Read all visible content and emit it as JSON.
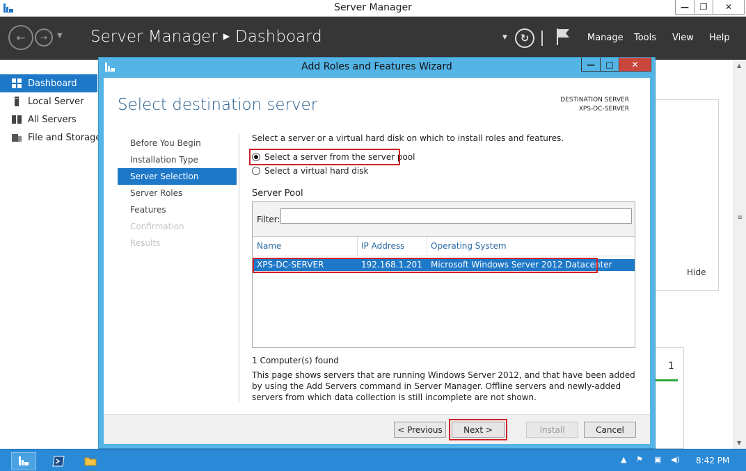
{
  "server_manager": {
    "window_title": "Server Manager",
    "breadcrumb_app": "Server Manager",
    "breadcrumb_page": "Dashboard",
    "menu": {
      "manage": "Manage",
      "tools": "Tools",
      "view": "View",
      "help": "Help"
    },
    "sidebar": [
      {
        "label": "Dashboard",
        "icon": "dashboard-icon"
      },
      {
        "label": "Local Server",
        "icon": "server-icon"
      },
      {
        "label": "All Servers",
        "icon": "servers-icon"
      },
      {
        "label": "File and Storage",
        "icon": "storage-icon"
      }
    ],
    "background_hide": "Hide",
    "background_count": "1"
  },
  "wizard": {
    "title": "Add Roles and Features Wizard",
    "heading": "Select destination server",
    "destination_label": "DESTINATION SERVER",
    "destination_name": "XPS-DC-SERVER",
    "steps": [
      {
        "label": "Before You Begin",
        "state": "normal"
      },
      {
        "label": "Installation Type",
        "state": "normal"
      },
      {
        "label": "Server Selection",
        "state": "active"
      },
      {
        "label": "Server Roles",
        "state": "normal"
      },
      {
        "label": "Features",
        "state": "normal"
      },
      {
        "label": "Confirmation",
        "state": "disabled"
      },
      {
        "label": "Results",
        "state": "disabled"
      }
    ],
    "intro": "Select a server or a virtual hard disk on which to install roles and features.",
    "option_pool": "Select a server from the server pool",
    "option_vhd": "Select a virtual hard disk",
    "pool_label": "Server Pool",
    "filter_label": "Filter:",
    "filter_value": "",
    "columns": {
      "name": "Name",
      "ip": "IP Address",
      "os": "Operating System"
    },
    "row": {
      "name": "XPS-DC-SERVER",
      "ip": "192.168.1.201",
      "os": "Microsoft Windows Server 2012 Datacenter"
    },
    "found": "1 Computer(s) found",
    "description": "This page shows servers that are running Windows Server 2012, and that have been added by using the Add Servers command in Server Manager. Offline servers and newly-added servers from which data collection is still incomplete are not shown.",
    "buttons": {
      "previous": "< Previous",
      "next": "Next >",
      "install": "Install",
      "cancel": "Cancel"
    }
  },
  "taskbar": {
    "clock": "8:42 PM"
  },
  "colors": {
    "accent": "#1e78c8",
    "wizard_frame": "#54b4e6",
    "highlight": "#d02028",
    "header": "#363636"
  }
}
